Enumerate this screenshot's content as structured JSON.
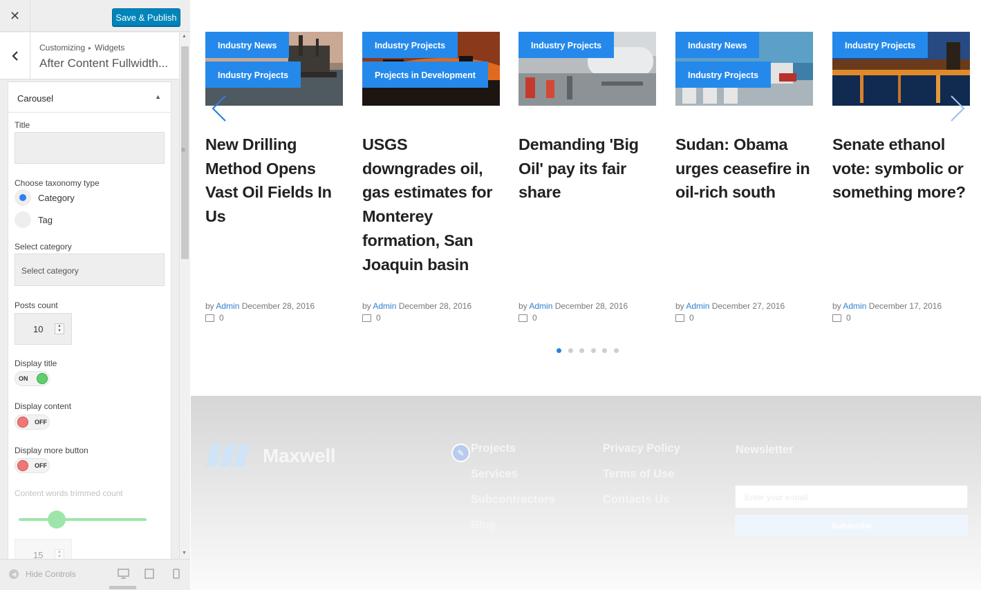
{
  "customizer": {
    "close_label": "✕",
    "publish_label": "Save & Publish",
    "breadcrumb": {
      "first": "Customizing",
      "separator": "▸",
      "second": "Widgets"
    },
    "section_title": "After Content Fullwidth...",
    "widget": {
      "name": "Carousel",
      "title_label": "Title",
      "title_value": "",
      "taxonomy_label": "Choose taxonomy type",
      "taxonomy_options": [
        "Category",
        "Tag"
      ],
      "taxonomy_selected": "Category",
      "category_label": "Select category",
      "category_placeholder": "Select category",
      "posts_count_label": "Posts count",
      "posts_count_value": "10",
      "display_title_label": "Display title",
      "display_title_state": "ON",
      "display_content_label": "Display content",
      "display_content_state": "OFF",
      "display_more_label": "Display more button",
      "display_more_state": "OFF",
      "trim_label": "Content words trimmed count",
      "trim_value": "15",
      "trim_slider_fraction": 0.27
    },
    "hide_controls_label": "Hide Controls",
    "devices": [
      "desktop-icon",
      "tablet-icon",
      "mobile-icon"
    ]
  },
  "preview": {
    "cards": [
      {
        "badges": [
          "Industry News",
          "Industry Projects"
        ],
        "title": "New Drilling Method Opens Vast Oil Fields In Us",
        "by": "by",
        "author": "Admin",
        "date": "December 28, 2016",
        "comments": "0"
      },
      {
        "badges": [
          "Industry Projects",
          "Projects in Development"
        ],
        "title": "USGS downgrades oil, gas estimates for Monterey formation, San Joaquin basin",
        "by": "by",
        "author": "Admin",
        "date": "December 28, 2016",
        "comments": "0"
      },
      {
        "badges": [
          "Industry Projects"
        ],
        "title": "Demanding 'Big Oil' pay its fair share",
        "by": "by",
        "author": "Admin",
        "date": "December 28, 2016",
        "comments": "0"
      },
      {
        "badges": [
          "Industry News",
          "Industry Projects"
        ],
        "title": "Sudan: Obama urges ceasefire in oil-rich south",
        "by": "by",
        "author": "Admin",
        "date": "December 27, 2016",
        "comments": "0"
      },
      {
        "badges": [
          "Industry Projects"
        ],
        "title": "Senate ethanol vote: symbolic or something more?",
        "by": "by",
        "author": "Admin",
        "date": "December 17, 2016",
        "comments": "0"
      }
    ],
    "pager": {
      "count": 6,
      "active": 0
    },
    "footer": {
      "logo_text": "Maxwell",
      "col1": [
        "Projects",
        "Services",
        "Subcontractors",
        "Blog"
      ],
      "col2": [
        "Privacy Policy",
        "Terms of Use",
        "Contacts Us"
      ],
      "newsletter_title": "Newsletter",
      "newsletter_placeholder": "Enter your e-mail",
      "subscribe_label": "Subscribe"
    }
  },
  "colors": {
    "accent": "#2589eb",
    "publish": "#0085ba",
    "toggle_on": "#5fcf6e",
    "toggle_off": "#f07777"
  }
}
